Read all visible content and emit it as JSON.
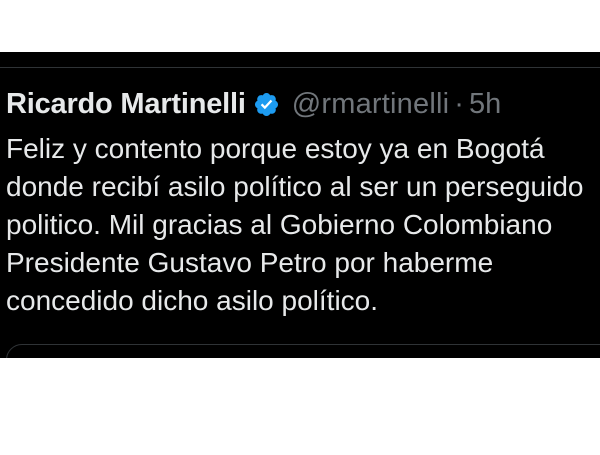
{
  "tweet": {
    "author": {
      "display_name": "Ricardo Martinelli",
      "handle": "@rmartinelli",
      "verified_icon": "verified-badge-icon",
      "verified_color": "#1d9bf0"
    },
    "separator": "·",
    "time": "5h",
    "text_lines": [
      "Feliz y contento porque estoy ya en Bogotá",
      "donde recibí asilo político al ser un perseguido",
      "politico. Mil gracias al Gobierno Colombiano",
      "Presidente Gustavo Petro por haberme",
      "concedido dicho asilo político."
    ]
  },
  "colors": {
    "background": "#000000",
    "text_primary": "#e7e9ea",
    "text_secondary": "#71767b",
    "border": "#2f3336"
  }
}
